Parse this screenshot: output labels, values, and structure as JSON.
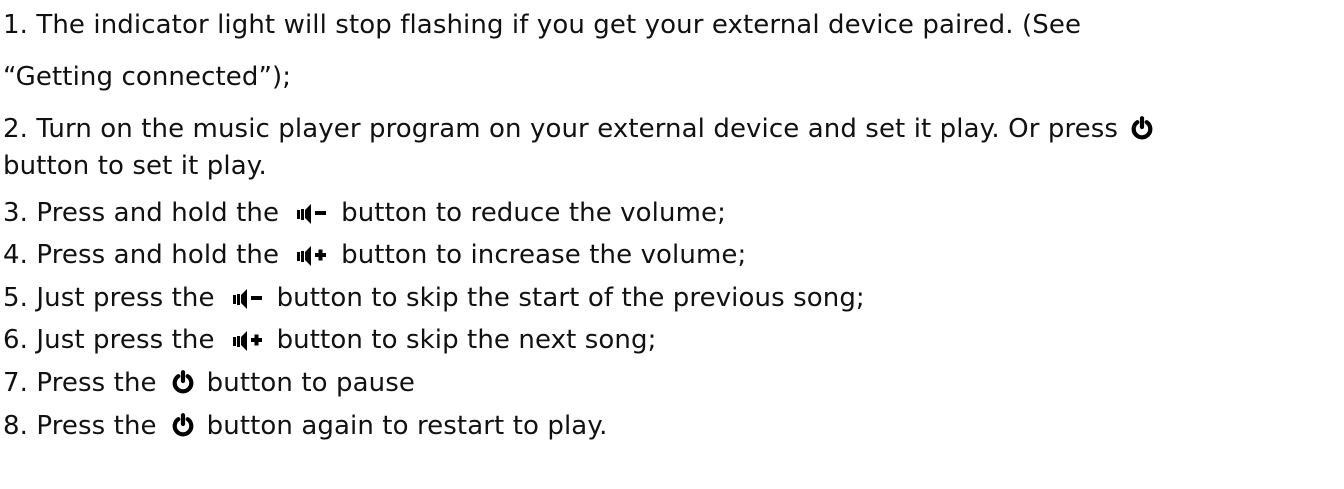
{
  "document": {
    "lines": [
      {
        "text": "1. The indicator light will stop flashing if you get your external device paired. (See"
      },
      {
        "text": "“Getting connected”);"
      },
      {
        "pre": "2. Turn on the music player program on your external device and set it play. Or press",
        "icon": "power-icon",
        "post": ""
      },
      {
        "text": "button to set it play."
      },
      {
        "pre": "3. Press and hold the",
        "icon": "volume-down-icon",
        "post": "button to reduce the volume;"
      },
      {
        "pre": "4. Press and hold the",
        "icon": "volume-up-icon",
        "post": "button to increase the volume;"
      },
      {
        "pre": "5. Just press the",
        "icon": "volume-down-icon",
        "post": "button to skip the start of the previous song;"
      },
      {
        "pre": "6. Just press the",
        "icon": "volume-up-icon",
        "post": "button to skip the next song;"
      },
      {
        "pre": "7. Press the",
        "icon": "power-icon",
        "post": "button to pause"
      },
      {
        "pre": "8. Press the",
        "icon": "power-icon",
        "post": "button again to restart to play."
      }
    ]
  }
}
